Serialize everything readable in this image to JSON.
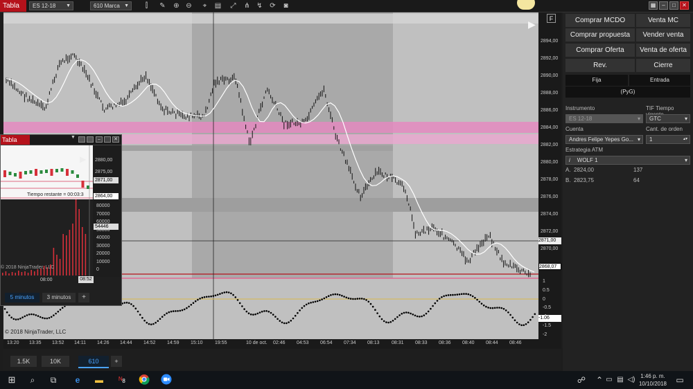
{
  "window": {
    "title": "Tabla",
    "instrument": "ES 12-18",
    "bar_type": "610 Marca",
    "f_label": "F"
  },
  "y_axis": {
    "ticks": [
      "2894,00",
      "2892,00",
      "2890,00",
      "2888,00",
      "2886,00",
      "2884,00",
      "2882,00",
      "2880,00",
      "2878,00",
      "2876,00",
      "2874,00",
      "2872,00",
      "2870,00"
    ],
    "badge_price": "2871,00",
    "badge_last": "2868,07",
    "osc_ticks": [
      "1",
      "0.5",
      "0",
      "-0.5",
      "-1",
      "-1.5",
      "-2"
    ],
    "badge_osc": "-1.06"
  },
  "x_axis": {
    "ticks": [
      "13:20",
      "13:35",
      "13:52",
      "14:11",
      "14:26",
      "14:44",
      "14:52",
      "14:59",
      "15:10",
      "19:55",
      "10 de oct.",
      "02:46",
      "04:53",
      "06:54",
      "07:34",
      "08:13",
      "08:31",
      "08:33",
      "08:36",
      "08:40",
      "08:44",
      "08:46"
    ]
  },
  "copyright": "© 2018 NinjaTrader, LLC",
  "bottom_tabs": [
    "1.5K",
    "10K",
    "610",
    "+"
  ],
  "order_panel": {
    "buttons": [
      [
        "Comprar MCDO",
        "Venta MC"
      ],
      [
        "Comprar propuesta",
        "Vender venta"
      ],
      [
        "Comprar Oferta",
        "Venta de oferta"
      ],
      [
        "Rev.",
        "Cierre"
      ]
    ],
    "fixed": "Fija",
    "entry": "Entrada",
    "pnl": "(PyG)",
    "instrument_label": "Instrumento",
    "instrument_value": "ES 12-18",
    "tif_label": "TIF Tiempo vigente",
    "tif_value": "GTC",
    "account_label": "Cuenta",
    "account_value": "Andres Felipe Yepes Go...",
    "qty_label": "Cant. de orden",
    "qty_value": "1",
    "atm_label": "Estrategia ATM",
    "atm_value": "WOLF 1",
    "positions": [
      {
        "side": "A.",
        "price": "2824,00",
        "qty": "137"
      },
      {
        "side": "B.",
        "price": "2823,75",
        "qty": "64"
      }
    ]
  },
  "inset": {
    "title": "Tabla",
    "price_ticks": [
      "2880,00",
      "2875,00"
    ],
    "badge_a": "2871,00",
    "badge_b": "2864,00",
    "remaining": "Tiempo restante = 00:03:3",
    "vol_ticks": [
      "80000",
      "70000",
      "60000",
      "50000",
      "40000",
      "30000",
      "20000",
      "10000",
      "0"
    ],
    "vol_badge": "54446",
    "copyright": "© 2018 NinjaTrader, LLC",
    "time_ticks": [
      "08:00",
      "08:52"
    ],
    "tabs": [
      "5 minutos",
      "3 minutos",
      "+"
    ]
  },
  "taskbar": {
    "time": "1:46 p. m.",
    "date": "10/10/2018",
    "badge": "8"
  },
  "colors": {
    "accent_red": "#b5121b",
    "band_pink": "#e080b8",
    "price_bar": "#111111",
    "ma_line": "#ffffff"
  }
}
